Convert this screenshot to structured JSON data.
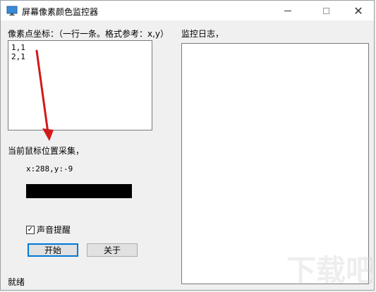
{
  "window": {
    "title": "屏幕像素颜色监控器",
    "controls": {
      "minimize": "—",
      "maximize": "□",
      "close": "✕"
    }
  },
  "coords": {
    "label": "像素点坐标：（一行一条。格式参考：x,y）",
    "value": "1,1\n2,1"
  },
  "log": {
    "label": "监控日志，"
  },
  "current": {
    "label": "当前鼠标位置采集，",
    "position": "x:288,y:-9",
    "swatch_color": "#000000"
  },
  "sound": {
    "label": "声音提醒",
    "checked": true
  },
  "buttons": {
    "start": "开始",
    "about": "关于"
  },
  "status": "就绪",
  "annotation": {
    "arrow_color": "#d11a1a"
  },
  "watermark": {
    "text": "下载吧",
    "color": "#cfcfcf"
  }
}
